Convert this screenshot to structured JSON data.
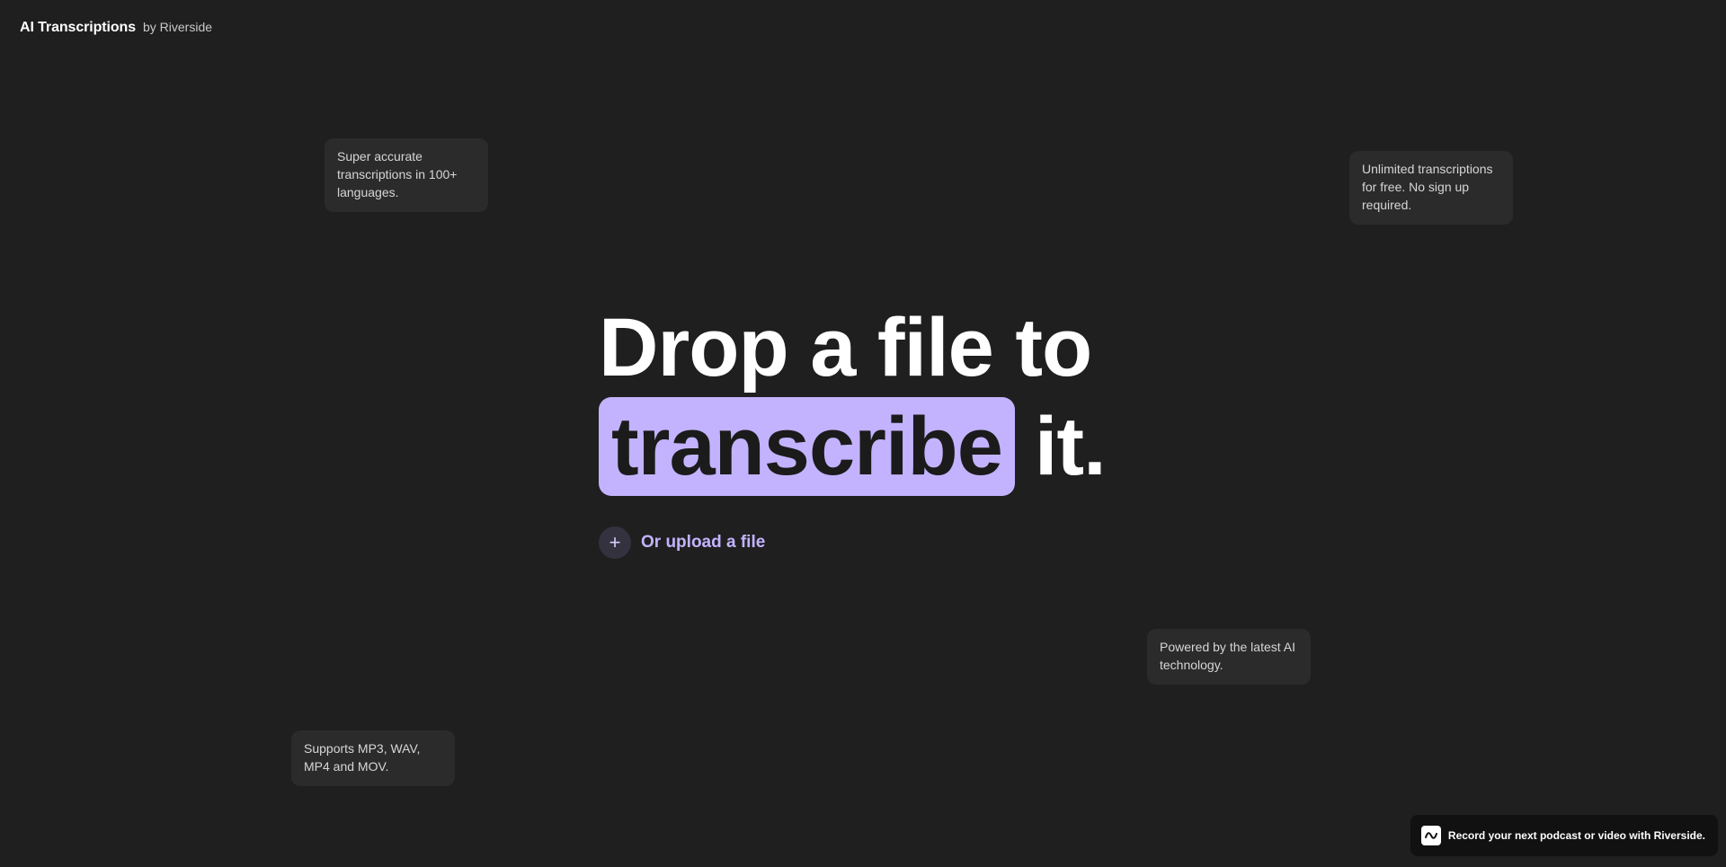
{
  "header": {
    "title": "AI Transcriptions",
    "by": "by Riverside"
  },
  "notes": [
    {
      "text": "Super accurate transcriptions in 100+ languages."
    },
    {
      "text": "Unlimited transcriptions for free. No sign up required."
    },
    {
      "text": "Powered by the latest AI technology."
    },
    {
      "text": "Supports MP3, WAV, MP4 and MOV."
    }
  ],
  "hero": {
    "line1": "Drop a file to",
    "highlight": "transcribe",
    "line2_rest": "it."
  },
  "upload": {
    "icon": "plus-icon",
    "icon_glyph": "+",
    "label": "Or upload a file"
  },
  "promo": {
    "icon": "riverside-logo-icon",
    "text": "Record your next podcast or video with Riverside."
  },
  "colors": {
    "background": "#1f1f1f",
    "accent": "#c3b3ff",
    "note_bg": "#2b2b2b"
  }
}
